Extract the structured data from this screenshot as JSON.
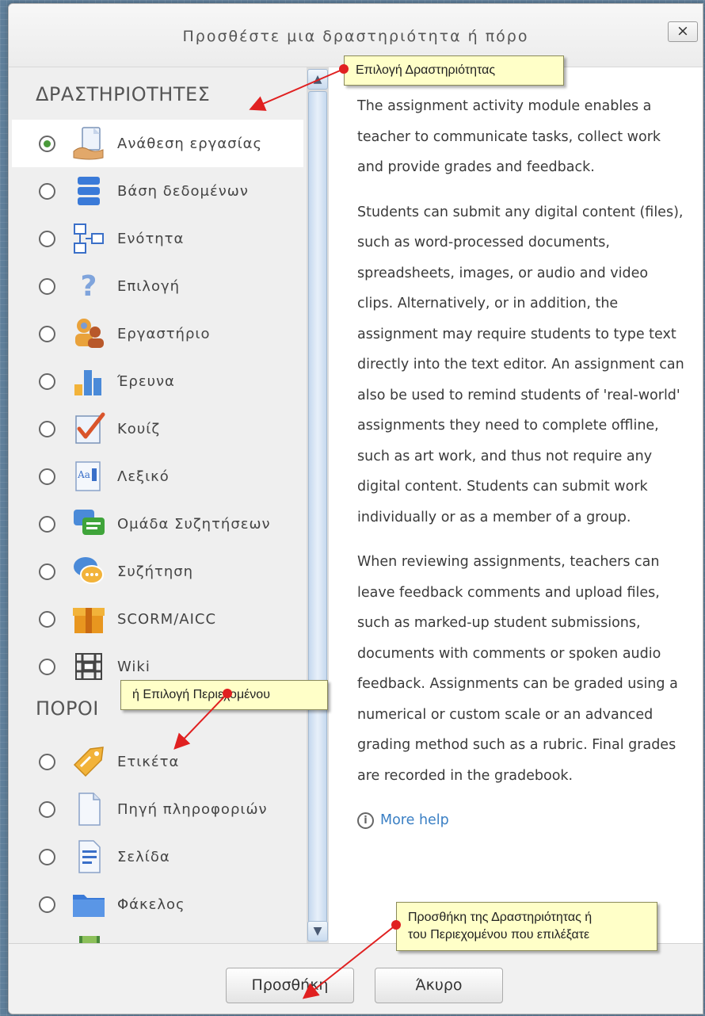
{
  "dialog": {
    "title": "Προσθέστε μια δραστηριότητα ή πόρο",
    "close_label": "×"
  },
  "sections": {
    "activities_heading": "ΔΡΑΣΤΗΡΙΟΤΗΤΕΣ",
    "resources_heading": "ΠΟΡΟΙ"
  },
  "activities": [
    {
      "label": "Ανάθεση εργασίας",
      "icon": "assignment-icon",
      "selected": true
    },
    {
      "label": "Βάση δεδομένων",
      "icon": "database-icon",
      "selected": false
    },
    {
      "label": "Ενότητα",
      "icon": "lesson-icon",
      "selected": false
    },
    {
      "label": "Επιλογή",
      "icon": "choice-icon",
      "selected": false
    },
    {
      "label": "Εργαστήριο",
      "icon": "workshop-icon",
      "selected": false
    },
    {
      "label": "Έρευνα",
      "icon": "survey-icon",
      "selected": false
    },
    {
      "label": "Κουίζ",
      "icon": "quiz-icon",
      "selected": false
    },
    {
      "label": "Λεξικό",
      "icon": "glossary-icon",
      "selected": false
    },
    {
      "label": "Ομάδα Συζητήσεων",
      "icon": "forum-icon",
      "selected": false
    },
    {
      "label": "Συζήτηση",
      "icon": "chat-icon",
      "selected": false
    },
    {
      "label": "SCORM/AICC",
      "icon": "scorm-icon",
      "selected": false
    },
    {
      "label": "Wiki",
      "icon": "wiki-icon",
      "selected": false
    }
  ],
  "resources": [
    {
      "label": "Ετικέτα",
      "icon": "label-icon"
    },
    {
      "label": "Πηγή πληροφοριών",
      "icon": "file-icon"
    },
    {
      "label": "Σελίδα",
      "icon": "page-icon"
    },
    {
      "label": "Φάκελος",
      "icon": "folder-icon"
    }
  ],
  "description": {
    "paragraphs": [
      "The assignment activity module enables a teacher to communicate tasks, collect work and provide grades and feedback.",
      "Students can submit any digital content (files), such as word-processed documents, spreadsheets, images, or audio and video clips. Alternatively, or in addition, the assignment may require students to type text directly into the text editor. An assignment can also be used to remind students of 'real-world' assignments they need to complete offline, such as art work, and thus not require any digital content. Students can submit work individually or as a member of a group.",
      "When reviewing assignments, teachers can leave feedback comments and upload files, such as marked-up student submissions, documents with comments or spoken audio feedback. Assignments can be graded using a numerical or custom scale or an advanced grading method such as a rubric. Final grades are recorded in the gradebook."
    ],
    "more_help": "More help"
  },
  "footer": {
    "add_label": "Προσθήκη",
    "cancel_label": "Άκυρο"
  },
  "callouts": {
    "activity": "Επιλογή Δραστηριότητας",
    "resource": "ή Επιλογή Περιεχομένου",
    "add_line1": "Προσθήκη της Δραστηριότητας ή",
    "add_line2": "του Περιεχομένου που επιλέξατε"
  },
  "colors": {
    "radio_checked": "#4a9a3a",
    "link": "#3a7fc4",
    "callout_bg": "#ffffc8",
    "callout_arrow": "#e02020"
  }
}
